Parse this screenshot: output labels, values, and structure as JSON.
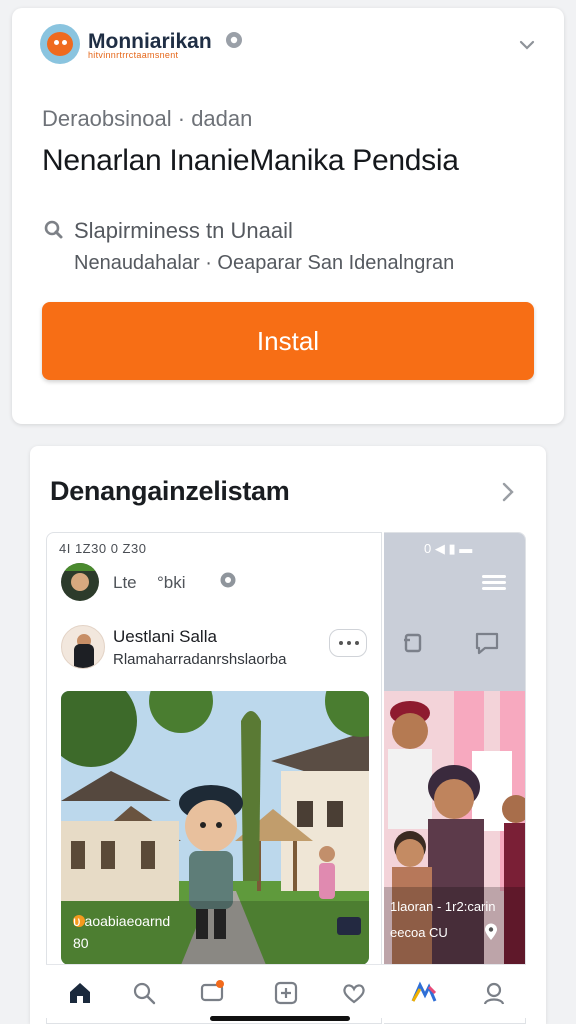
{
  "app_card": {
    "developer": {
      "name": "Monniarikan",
      "subtitle": "hitvinnrtrrctaamsnent",
      "logo_icon": "owl-logo-icon",
      "verified_icon": "verified-badge-icon"
    },
    "close_icon": "chevron-down-icon",
    "category": "Deraobsinoal · dadan",
    "title": "Nenarlan InanieManika Pendsia",
    "meta_icon": "location-pin-icon",
    "meta_line1": "Slapirminess tn Unaail",
    "meta_line2": "Nenaudahalar · Oeaparar San Idenalngran",
    "install_label": "Instal",
    "colors": {
      "accent": "#f76e15",
      "developer_subtitle": "#e5671a"
    }
  },
  "preview": {
    "section_title": "Denangainzelistam",
    "chevron_icon": "chevron-right-icon",
    "screen1": {
      "status_text": "4I 1Z30 0 Z30",
      "profile_label1": "Lte",
      "profile_label2": "°bki",
      "post_name": "Uestlani Salla",
      "post_subtitle": "Rlamaharradanrshslaorba",
      "photo_caption1": "ʋ aoabiaeoarnd",
      "photo_caption2": "80"
    },
    "screen2": {
      "status_text": "0 ◀ ▮ ▬",
      "photo_caption1": "1laoran - 1r2:carin",
      "photo_caption2": "eecoa CU"
    },
    "bottom_nav": [
      {
        "icon": "home-icon"
      },
      {
        "icon": "search-icon"
      },
      {
        "icon": "chat-icon"
      },
      {
        "icon": "add-icon"
      },
      {
        "icon": "heart-icon"
      },
      {
        "icon": "rainbow-icon"
      },
      {
        "icon": "profile-icon"
      }
    ]
  }
}
